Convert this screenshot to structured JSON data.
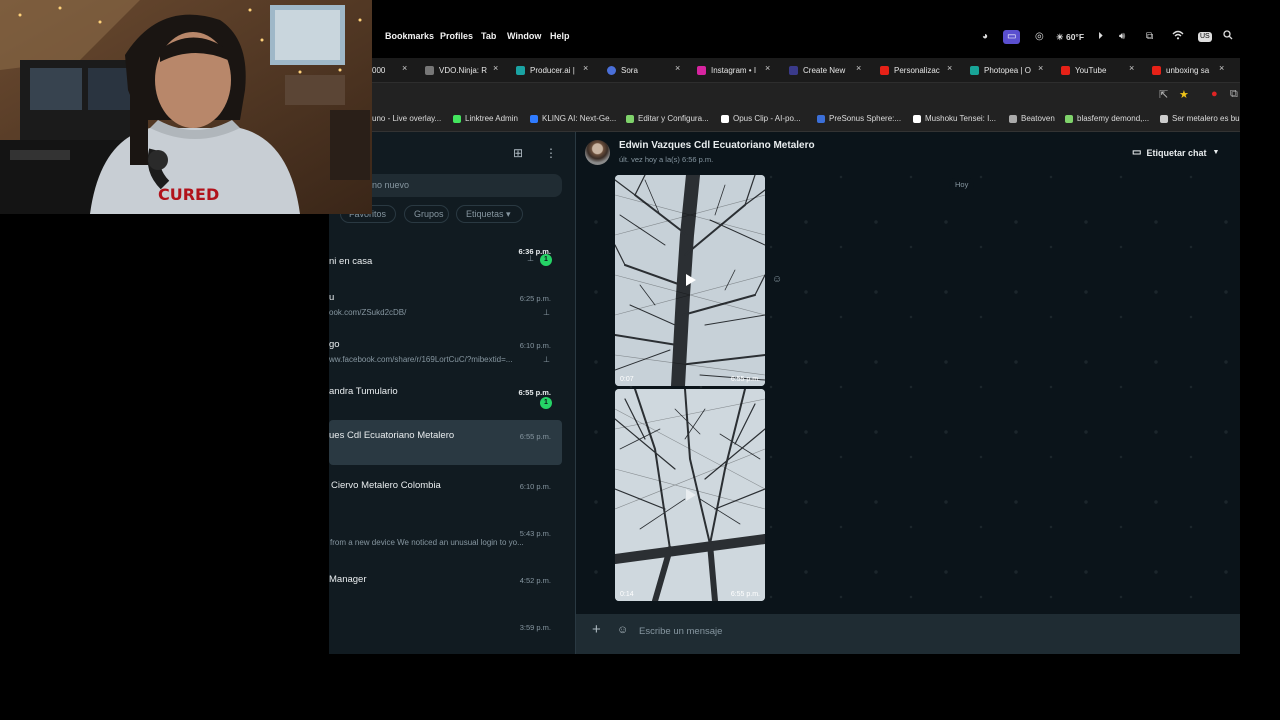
{
  "menubar": {
    "items": [
      "Bookmarks",
      "Profiles",
      "Tab",
      "Window",
      "Help"
    ],
    "weather": "☀ 60°F",
    "input_source": "US"
  },
  "tabs": [
    {
      "label": "000",
      "icon": "generic-tab-icon",
      "color": "#666666"
    },
    {
      "label": "VDO.Ninja: R",
      "icon": "vdo-ninja-icon",
      "color": "#888888"
    },
    {
      "label": "Producer.ai |",
      "icon": "producer-icon",
      "color": "#1aa3a3"
    },
    {
      "label": "Sora",
      "icon": "sora-icon",
      "color": "#4a6fd8"
    },
    {
      "label": "Instagram • I",
      "icon": "instagram-icon",
      "color": "#d6249f"
    },
    {
      "label": "Create New",
      "icon": "create-icon",
      "color": "#3a3a8a"
    },
    {
      "label": "Personalizac",
      "icon": "youtube-icon",
      "color": "#e62117"
    },
    {
      "label": "Photopea | O",
      "icon": "photopea-icon",
      "color": "#18a497"
    },
    {
      "label": "YouTube",
      "icon": "youtube-icon",
      "color": "#e62117"
    },
    {
      "label": "unboxing sa",
      "icon": "youtube-icon",
      "color": "#e62117"
    }
  ],
  "bookmarks": [
    {
      "label": "uno - Live overlay...",
      "icon": "none"
    },
    {
      "label": "Linktree Admin",
      "icon": "linktree-icon",
      "color": "#43e55e"
    },
    {
      "label": "KLING AI: Next-Ge...",
      "icon": "kling-icon",
      "color": "#2f7bff"
    },
    {
      "label": "Editar y Configura...",
      "icon": "edit-icon",
      "color": "#7fd36b"
    },
    {
      "label": "Opus Clip - AI-po...",
      "icon": "opus-icon",
      "color": "#ffffff"
    },
    {
      "label": "PreSonus Sphere:...",
      "icon": "presonus-icon",
      "color": "#3b6fd8"
    },
    {
      "label": "Mushoku Tensei: I...",
      "icon": "anime-icon",
      "color": "#ffffff"
    },
    {
      "label": "Beatoven",
      "icon": "beatoven-icon",
      "color": "#aaaaaa"
    },
    {
      "label": "blasfemy demond,...",
      "icon": "music-icon",
      "color": "#7fd36b"
    },
    {
      "label": "Ser metalero es bu",
      "icon": "page-icon",
      "color": "#cccccc"
    }
  ],
  "sidebar": {
    "search_placeholder": "no nuevo",
    "filters": [
      "Favoritos",
      "Grupos",
      "Etiquetas ▾"
    ],
    "chats": [
      {
        "name": "ni en casa",
        "time": "6:36 p.m.",
        "preview": "",
        "unread": "1",
        "pinned": true,
        "time_bold": true
      },
      {
        "name": "u",
        "time": "6:25 p.m.",
        "preview": "ook.com/ZSukd2cDB/",
        "unread": "",
        "pinned": true,
        "time_bold": false
      },
      {
        "name": "go",
        "time": "6:10 p.m.",
        "preview": "ww.facebook.com/share/r/169LortCuC/?mibextid=...",
        "unread": "",
        "pinned": true,
        "time_bold": false
      },
      {
        "name": "andra Tumulario",
        "time": "6:55 p.m.",
        "preview": "",
        "unread": "1",
        "pinned": false,
        "time_bold": true
      },
      {
        "name": "ues Cdl Ecuatoriano Metalero",
        "time": "6:55 p.m.",
        "preview": "",
        "unread": "",
        "pinned": false,
        "time_bold": false,
        "active": true
      },
      {
        "name": "Ciervo Metalero Colombia",
        "time": "6:10 p.m.",
        "preview": "",
        "unread": "",
        "pinned": false,
        "time_bold": false
      },
      {
        "name": "",
        "time": "5:43 p.m.",
        "preview": "from a new device We noticed an unusual login to yo...",
        "unread": "",
        "pinned": false,
        "time_bold": false
      },
      {
        "name": "Manager",
        "time": "4:52 p.m.",
        "preview": "",
        "unread": "",
        "pinned": false,
        "time_bold": false
      },
      {
        "name": "",
        "time": "3:59 p.m.",
        "preview": "",
        "unread": "",
        "pinned": false,
        "time_bold": false
      }
    ]
  },
  "chat": {
    "contact_name": "Edwin Vazques Cdl Ecuatoriano Metalero",
    "status": "últ. vez hoy a la(s) 6:56 p.m.",
    "label_button": "Etiquetar chat",
    "date_separator": "Hoy",
    "videos": [
      {
        "duration": "0:07",
        "time": "6:55 p.m."
      },
      {
        "duration": "0:14",
        "time": "6:55 p.m."
      }
    ],
    "composer_placeholder": "Escribe un mensaje"
  }
}
